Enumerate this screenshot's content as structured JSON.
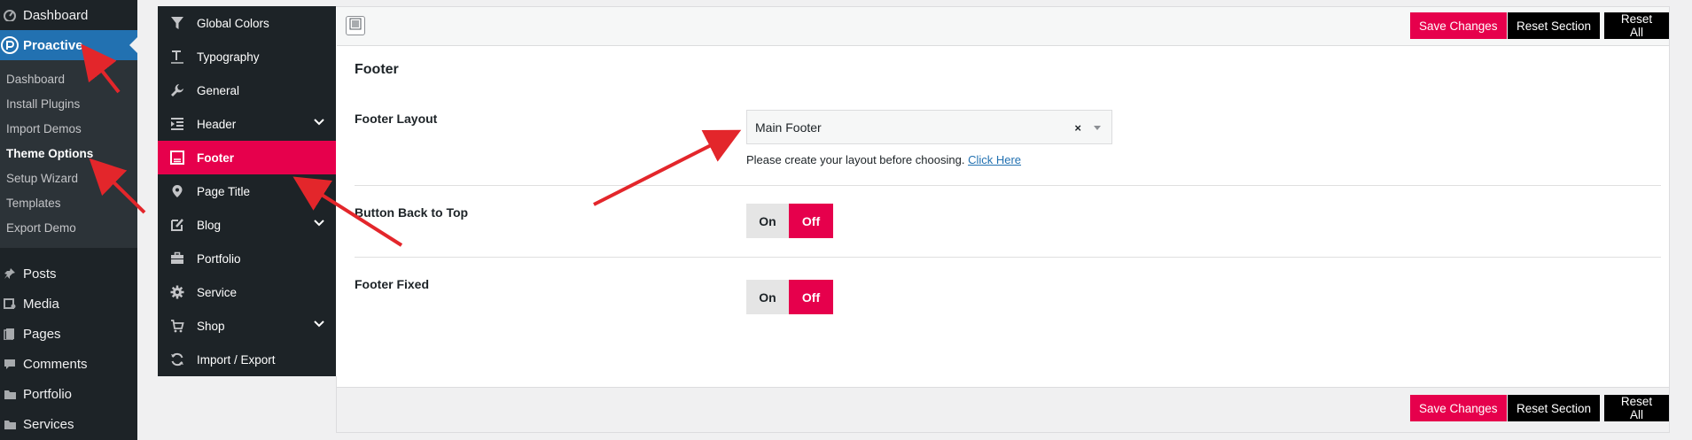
{
  "wp_menu": {
    "dashboard": "Dashboard",
    "proactive": "Proactive",
    "submenu": [
      "Dashboard",
      "Install Plugins",
      "Import Demos",
      "Theme Options",
      "Setup Wizard",
      "Templates",
      "Export Demo"
    ],
    "posts": "Posts",
    "media": "Media",
    "pages": "Pages",
    "comments": "Comments",
    "portfolio": "Portfolio",
    "services": "Services"
  },
  "options_nav": [
    {
      "label": "Global Colors",
      "icon": "filter-icon"
    },
    {
      "label": "Typography",
      "icon": "typography-icon"
    },
    {
      "label": "General",
      "icon": "wrench-icon"
    },
    {
      "label": "Header",
      "icon": "indent-icon"
    },
    {
      "label": "Footer",
      "icon": "footer-icon"
    },
    {
      "label": "Page Title",
      "icon": "map-pin-icon"
    },
    {
      "label": "Blog",
      "icon": "edit-icon"
    },
    {
      "label": "Portfolio",
      "icon": "briefcase-icon"
    },
    {
      "label": "Service",
      "icon": "gear-icon"
    },
    {
      "label": "Shop",
      "icon": "cart-icon"
    },
    {
      "label": "Import / Export",
      "icon": "refresh-icon"
    }
  ],
  "toolbar": {
    "save_label": "Save Changes",
    "reset_section_label": "Reset Section",
    "reset_all_label": "Reset All"
  },
  "section": {
    "title": "Footer",
    "footer_layout_label": "Footer Layout",
    "footer_layout_value": "Main Footer",
    "footer_layout_clear": "×",
    "footer_layout_desc": "Please create your layout before choosing.",
    "footer_layout_link": "Click Here",
    "back_to_top_label": "Button Back to Top",
    "footer_fixed_label": "Footer Fixed",
    "toggle_on": "On",
    "toggle_off": "Off"
  },
  "colors": {
    "accent": "#e6004c",
    "wp_blue": "#2271b1",
    "annotation_red": "#e3262b"
  }
}
